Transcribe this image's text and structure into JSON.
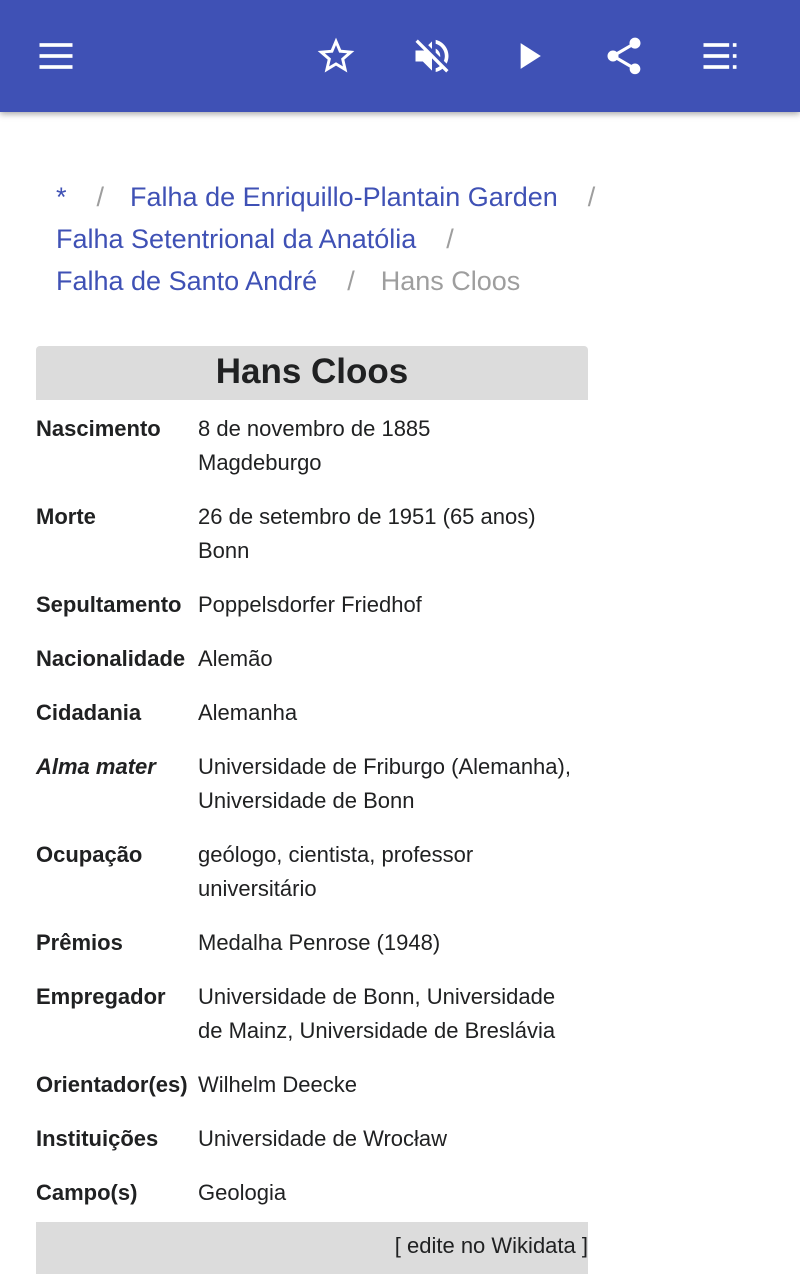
{
  "toolbar": {
    "menu_icon": "hamburger-menu-icon",
    "star_icon": "star-outline-icon",
    "mute_icon": "volume-off-icon",
    "play_icon": "play-icon",
    "share_icon": "share-icon",
    "list_icon": "list-view-icon",
    "bar_color": "#3f51b5"
  },
  "breadcrumb": {
    "items": [
      "*",
      "Falha de Enriquillo-Plantain Garden",
      "Falha Setentrional da Anatólia",
      "Falha de Santo André"
    ],
    "separator": "/",
    "current": "Hans Cloos",
    "link_color": "#3f51b5"
  },
  "infobox": {
    "title": "Hans Cloos",
    "rows": [
      {
        "label": "Nascimento",
        "value": [
          "8 de novembro de 1885",
          "Magdeburgo"
        ]
      },
      {
        "label": "Morte",
        "value": [
          "26 de setembro de 1951 (65 anos)",
          "Bonn"
        ]
      },
      {
        "label": "Sepultamento",
        "value": [
          "Poppelsdorfer Friedhof"
        ]
      },
      {
        "label": "Nacionalidade",
        "value": [
          "Alemão"
        ]
      },
      {
        "label": "Cidadania",
        "value": [
          "Alemanha"
        ]
      },
      {
        "label": "Alma mater",
        "value": [
          "Universidade de Friburgo (Alemanha),",
          "Universidade de Bonn"
        ]
      },
      {
        "label": "Ocupação",
        "value": [
          "geólogo, cientista, professor",
          "universitário"
        ]
      },
      {
        "label": "Prêmios",
        "value": [
          "Medalha Penrose (1948)"
        ]
      },
      {
        "label": "Empregador",
        "value": [
          "Universidade de Bonn, Universidade",
          "de Mainz, Universidade de Breslávia"
        ]
      },
      {
        "label": "Orientador(es)",
        "value": [
          "Wilhelm Deecke"
        ]
      },
      {
        "label": "Instituições",
        "value": [
          "Universidade de Wrocław"
        ]
      },
      {
        "label": "Campo(s)",
        "value": [
          "Geologia"
        ]
      }
    ],
    "footer": "[ edite no Wikidata ]"
  }
}
